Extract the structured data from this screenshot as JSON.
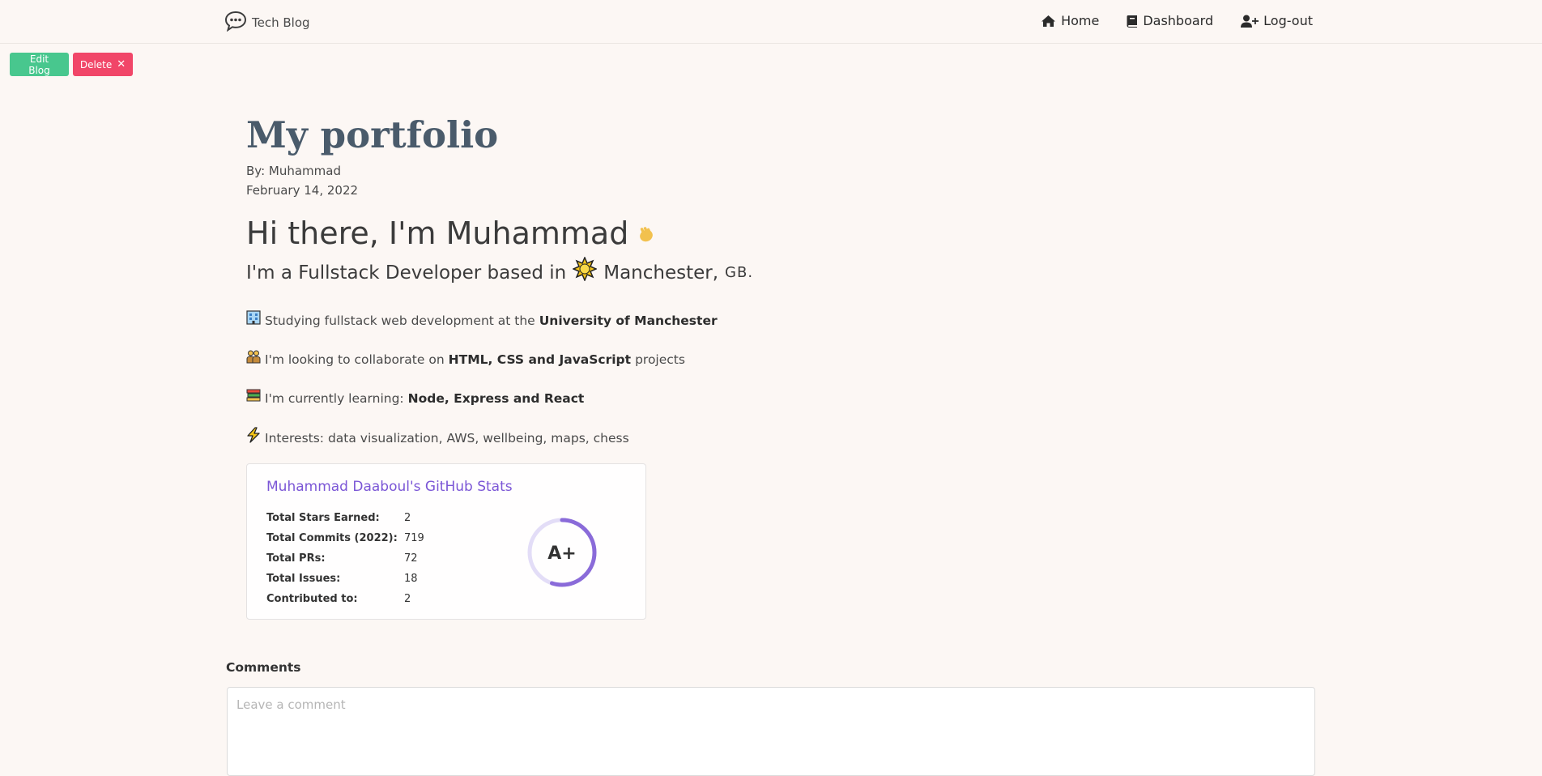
{
  "navbar": {
    "brand": "Tech Blog",
    "links": [
      {
        "label": "Home",
        "icon": "home-icon"
      },
      {
        "label": "Dashboard",
        "icon": "book-icon"
      },
      {
        "label": "Log-out",
        "icon": "user-plus-icon"
      }
    ]
  },
  "actions": {
    "edit_label": "Edit Blog",
    "delete_label": "Delete",
    "delete_icon": "close-icon"
  },
  "post": {
    "title": "My portfolio",
    "author": "By: Muhammad",
    "date": "February 14, 2022",
    "greeting": "Hi there, I'm Muhammad",
    "greeting_emoji": "waving-hand-icon",
    "subline_pre": "I'm a Fullstack Developer based in",
    "subline_emoji": "sun-icon",
    "subline_city": "Manchester,",
    "subline_country": "GB.",
    "bullets": [
      {
        "icon": "building-icon",
        "pre": "Studying fullstack web development at the ",
        "bold": "University of Manchester",
        "post": ""
      },
      {
        "icon": "people-icon",
        "pre": "I'm looking to collaborate on ",
        "bold": "HTML, CSS and JavaScript",
        "post": " projects"
      },
      {
        "icon": "books-icon",
        "pre": "I'm currently learning: ",
        "bold": "Node, Express and React",
        "post": ""
      },
      {
        "icon": "lightning-icon",
        "pre": "Interests: data visualization, AWS, wellbeing, maps, chess",
        "bold": "",
        "post": ""
      }
    ]
  },
  "github_stats": {
    "title": "Muhammad Daaboul's GitHub Stats",
    "rows": [
      {
        "label": "Total Stars Earned:",
        "value": "2"
      },
      {
        "label": "Total Commits (2022):",
        "value": "719"
      },
      {
        "label": "Total PRs:",
        "value": "72"
      },
      {
        "label": "Total Issues:",
        "value": "18"
      },
      {
        "label": "Contributed to:",
        "value": "2"
      }
    ],
    "grade": "A+",
    "grade_ring_fraction": 0.55,
    "accent": "#7b56d6"
  },
  "comments": {
    "label": "Comments",
    "placeholder": "Leave a comment"
  },
  "colors": {
    "background": "#fcf7f4",
    "edit_button": "#48c78e",
    "delete_button": "#f14668",
    "title": "#4a5b6b"
  }
}
